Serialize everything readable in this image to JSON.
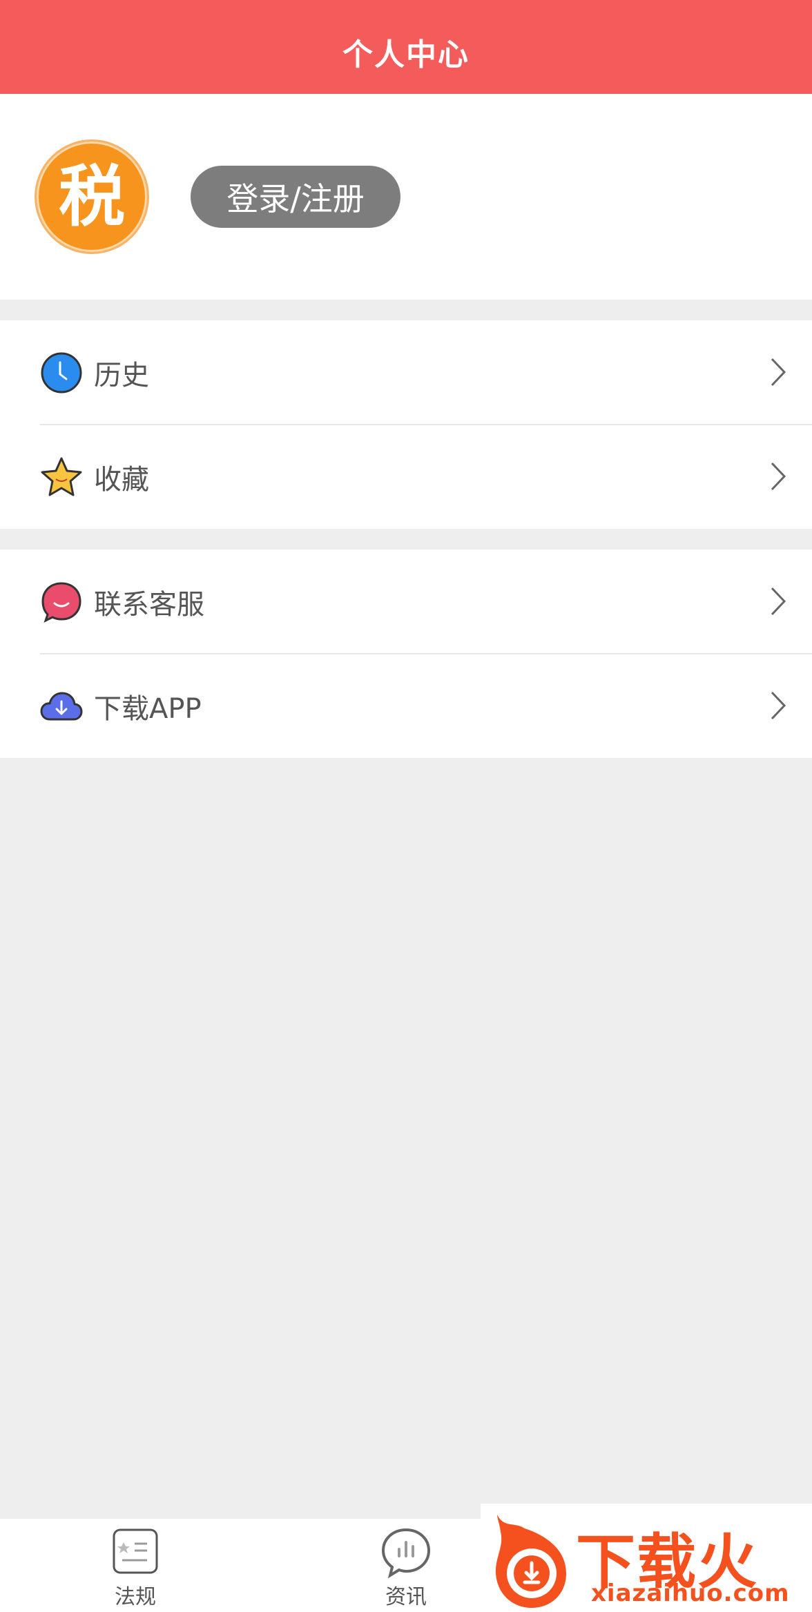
{
  "header": {
    "title": "个人中心"
  },
  "profile": {
    "avatar_text": "税",
    "login_label": "登录/注册"
  },
  "menu": {
    "group1": [
      {
        "label": "历史",
        "icon": "clock-icon"
      },
      {
        "label": "收藏",
        "icon": "star-icon"
      }
    ],
    "group2": [
      {
        "label": "联系客服",
        "icon": "chat-bubble-icon"
      },
      {
        "label": "下载APP",
        "icon": "cloud-download-icon"
      }
    ]
  },
  "tabbar": {
    "tabs": [
      {
        "label": "法规",
        "icon": "document-list-icon"
      },
      {
        "label": "资讯",
        "icon": "chart-bubble-icon"
      }
    ]
  },
  "watermark": {
    "text": "下载火",
    "url": "xiazaihuo.com"
  },
  "colors": {
    "header_bg": "#f45b5b",
    "avatar_bg": "#f7941d",
    "login_bg": "#7d7d7d",
    "page_bg": "#eeeeee",
    "watermark": "#f4511e"
  }
}
